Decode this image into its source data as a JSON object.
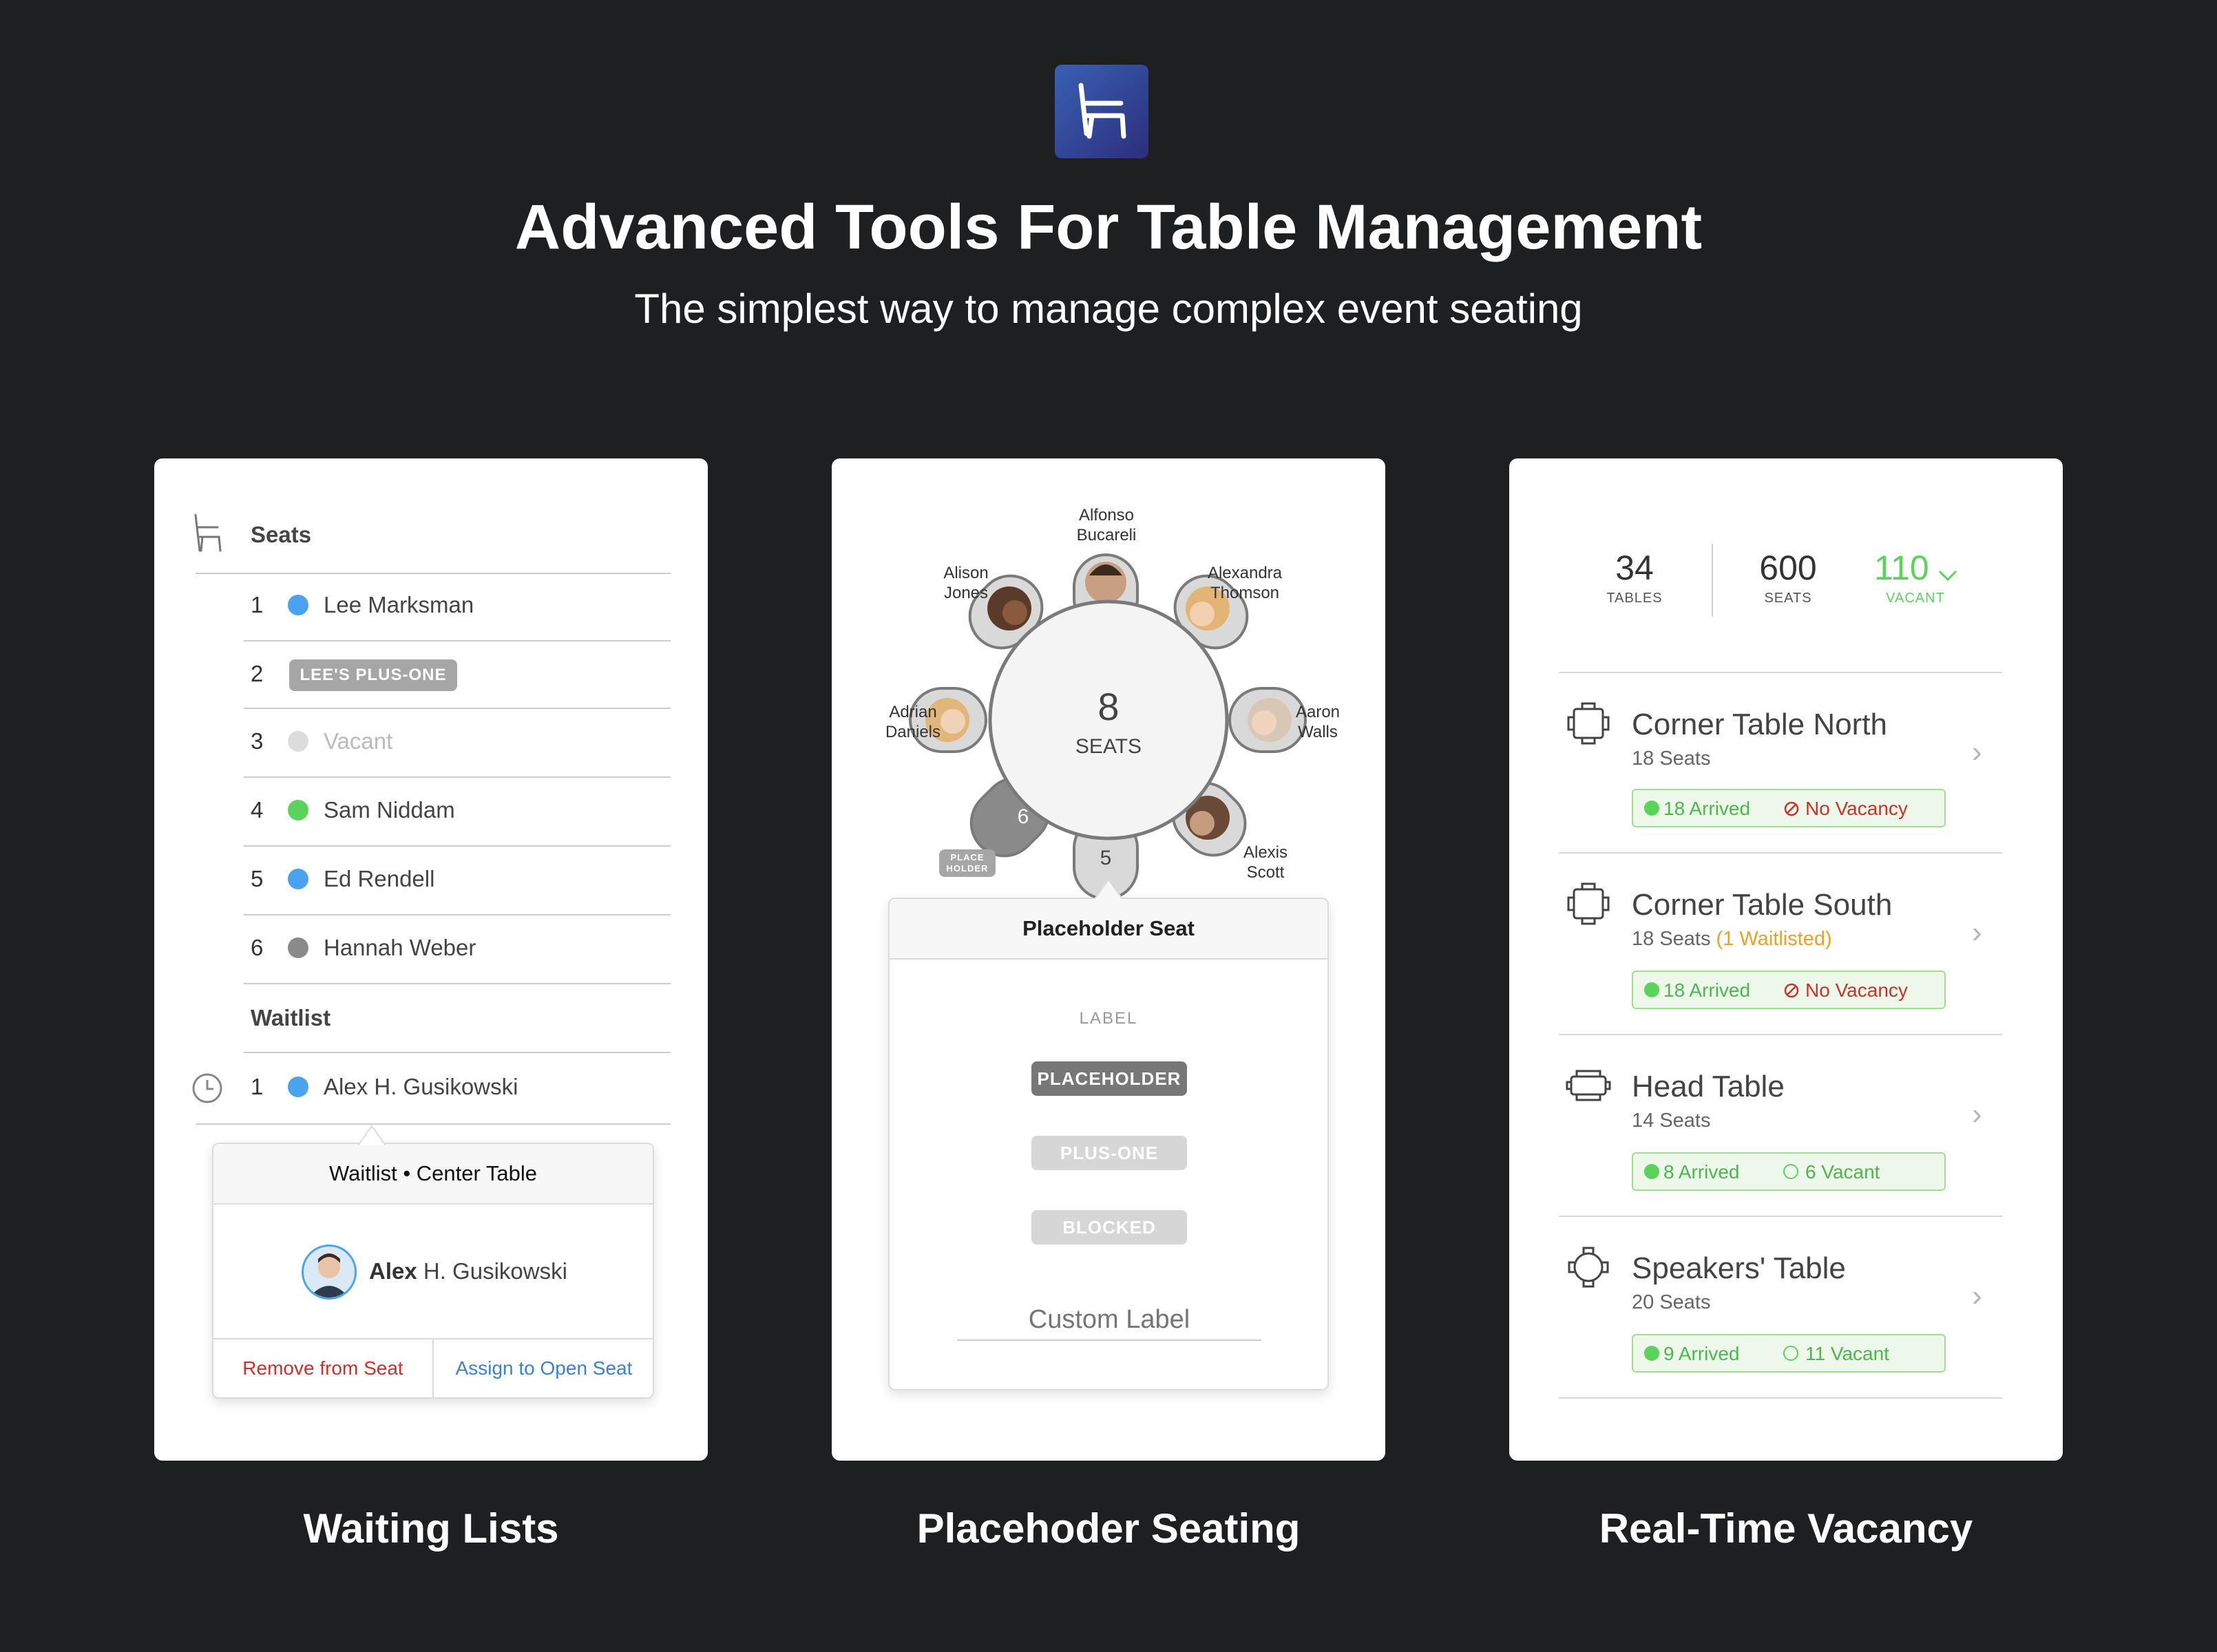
{
  "hero": {
    "title": "Advanced Tools For Table Management",
    "subtitle": "The simplest way to manage complex event seating",
    "app_icon": "chair-icon"
  },
  "colors": {
    "background": "#1e1f21",
    "blue": "#4aa3f0",
    "green": "#5ad35a",
    "gray": "#8a8a8a",
    "red": "#d0302a",
    "orange": "#f0a020",
    "link": "#3a82d6"
  },
  "waiting_lists": {
    "caption": "Waiting Lists",
    "seats_header": "Seats",
    "seats": [
      {
        "num": "1",
        "name": "Lee Marksman",
        "status": "blue"
      },
      {
        "num": "2",
        "name": "LEE'S PLUS-ONE",
        "status": "tag"
      },
      {
        "num": "3",
        "name": "Vacant",
        "status": "vacant"
      },
      {
        "num": "4",
        "name": "Sam Niddam",
        "status": "green"
      },
      {
        "num": "5",
        "name": "Ed Rendell",
        "status": "blue"
      },
      {
        "num": "6",
        "name": "Hannah Weber",
        "status": "gray"
      }
    ],
    "waitlist_header": "Waitlist",
    "waitlist": [
      {
        "num": "1",
        "name": "Alex H. Gusikowski"
      }
    ],
    "popover": {
      "title": "Waitlist • Center Table",
      "first_name": "Alex",
      "rest_name": "H. Gusikowski",
      "remove": "Remove from Seat",
      "assign": "Assign to Open Seat"
    }
  },
  "placeholder_seating": {
    "caption": "Placehoder Seating",
    "table": {
      "count": "8",
      "unit": "SEATS"
    },
    "guests": [
      {
        "first": "Alfonso",
        "last": "Bucareli"
      },
      {
        "first": "Alexandra",
        "last": "Thomson"
      },
      {
        "first": "Aaron",
        "last": "Walls"
      },
      {
        "first": "Alexis",
        "last": "Scott"
      },
      {
        "first": "Adrian",
        "last": "Daniels"
      },
      {
        "first": "Alison",
        "last": "Jones"
      }
    ],
    "seat_5": "5",
    "seat_6": "6",
    "placeholder_tag_1": "PLACE",
    "placeholder_tag_2": "HOLDER",
    "popover": {
      "title": "Placeholder Seat",
      "label_header": "LABEL",
      "options": [
        "PLACEHOLDER",
        "PLUS-ONE",
        "BLOCKED"
      ],
      "custom_placeholder": "Custom Label"
    }
  },
  "realtime_vacancy": {
    "caption": "Real-Time Vacancy",
    "stats": {
      "tables": "34",
      "tables_label": "TABLES",
      "seats": "600",
      "seats_label": "SEATS",
      "vacant": "110",
      "vacant_label": "VACANT"
    },
    "tables": [
      {
        "name": "Corner Table North",
        "seats": "18 Seats",
        "note": "",
        "arrived": "18 Arrived",
        "vacancy": "No Vacancy",
        "vacancy_type": "none",
        "icon": "square-table-icon"
      },
      {
        "name": "Corner Table South",
        "seats": "18 Seats",
        "note": "(1 Waitlisted)",
        "arrived": "18 Arrived",
        "vacancy": "No Vacancy",
        "vacancy_type": "none",
        "icon": "square-table-icon"
      },
      {
        "name": "Head Table",
        "seats": "14 Seats",
        "note": "",
        "arrived": "8 Arrived",
        "vacancy": "6 Vacant",
        "vacancy_type": "open",
        "icon": "rectangle-table-icon"
      },
      {
        "name": "Speakers' Table",
        "seats": "20 Seats",
        "note": "",
        "arrived": "9 Arrived",
        "vacancy": "11 Vacant",
        "vacancy_type": "open",
        "icon": "round-table-icon"
      }
    ]
  }
}
